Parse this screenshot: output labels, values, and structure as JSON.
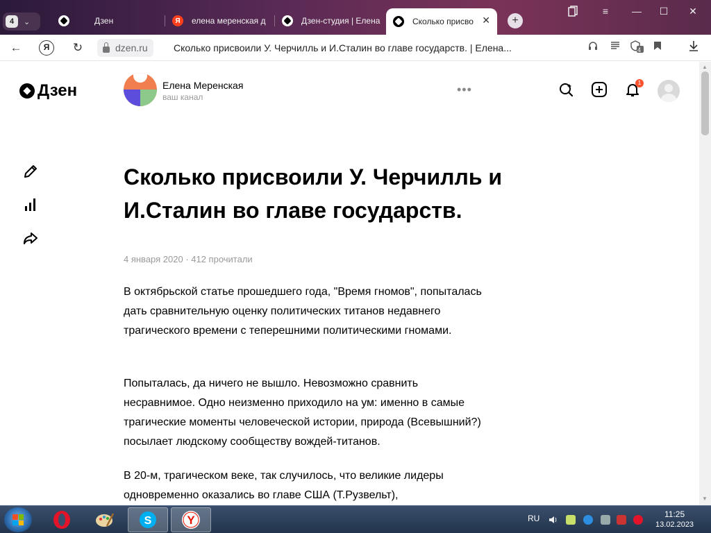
{
  "browser": {
    "tab_count": "4",
    "tabs": [
      {
        "label": "Дзен"
      },
      {
        "label": "елена меренская д"
      },
      {
        "label": "Дзен-студия | Елена"
      },
      {
        "label": "Сколько присво"
      }
    ],
    "url_domain": "dzen.ru",
    "page_title": "Сколько присвоили У. Черчилль и И.Сталин во главе государств. | Елена...",
    "ya_label": "Я",
    "share_count": "4"
  },
  "header": {
    "logo_text": "Дзен",
    "channel_name": "Елена Меренская",
    "channel_subtitle": "ваш канал",
    "more_label": "•••",
    "notification_count": "1"
  },
  "article": {
    "title": "Сколько присвоили У. Черчилль и И.Сталин во главе государств.",
    "meta": "4 января 2020 · 412 прочитали",
    "paragraphs": [
      "В октябрьской статье прошедшего года, \"Время гномов\", попыталась дать сравнительную оценку политических титанов недавнего трагического времени с теперешними политическими гномами.",
      "Попыталась, да ничего не вышло. Невозможно сравнить несравнимое. Одно неизменно приходило на ум: именно в самые трагические моменты человеческой истории, природа (Всевышний?) посылает людскому сообществу вождей-титанов.",
      "В 20-м, трагическом веке, так случилось, что великие лидеры одновременно оказались во главе США (Т.Рузвельт),"
    ]
  },
  "taskbar": {
    "language": "RU",
    "time": "11:25",
    "date": "13.02.2023"
  },
  "colors": {
    "accent": "#fc5230",
    "yandex_red": "#fc3f1d"
  }
}
